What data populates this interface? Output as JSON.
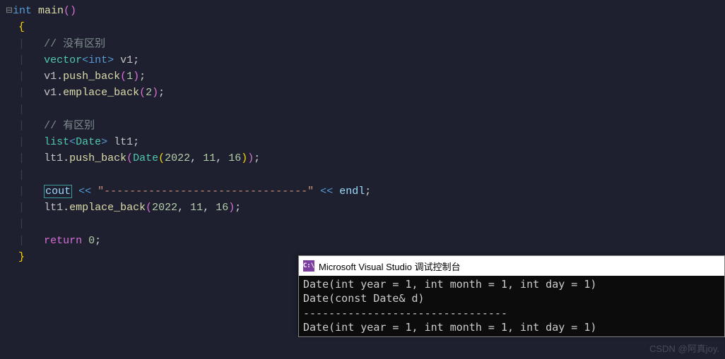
{
  "code": {
    "func_decl": {
      "type": "int",
      "name": "main"
    },
    "comment1": "// 没有区别",
    "vector_decl": {
      "container": "vector",
      "elem_type": "int",
      "var": "v1"
    },
    "push1": {
      "obj": "v1",
      "method": "push_back",
      "arg": "1"
    },
    "emplace1": {
      "obj": "v1",
      "method": "emplace_back",
      "arg": "2"
    },
    "comment2": "// 有区别",
    "list_decl": {
      "container": "list",
      "elem_type": "Date",
      "var": "lt1"
    },
    "push2": {
      "obj": "lt1",
      "method": "push_back",
      "ctor": "Date",
      "args": [
        "2022",
        "11",
        "16"
      ]
    },
    "cout_line": {
      "stream": "cout",
      "op": "<<",
      "dash": "\"--------------------------------\"",
      "endl": "endl"
    },
    "emplace2": {
      "obj": "lt1",
      "method": "emplace_back",
      "args": [
        "2022",
        "11",
        "16"
      ]
    },
    "return_stmt": {
      "kw": "return",
      "val": "0"
    }
  },
  "console": {
    "icon_text": "C:\\",
    "title": "Microsoft Visual Studio 调试控制台",
    "lines": [
      "Date(int year = 1, int month = 1, int day = 1)",
      "Date(const Date& d)",
      "--------------------------------",
      "Date(int year = 1, int month = 1, int day = 1)"
    ]
  },
  "watermark": "CSDN @阿真joy."
}
